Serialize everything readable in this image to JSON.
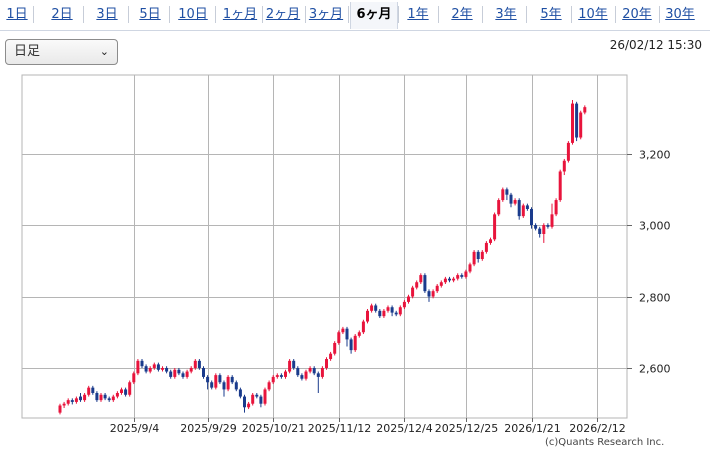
{
  "tabs": [
    {
      "label": "1日",
      "active": false
    },
    {
      "label": "2日",
      "active": false
    },
    {
      "label": "3日",
      "active": false
    },
    {
      "label": "5日",
      "active": false
    },
    {
      "label": "10日",
      "active": false
    },
    {
      "label": "1ヶ月",
      "active": false
    },
    {
      "label": "2ヶ月",
      "active": false
    },
    {
      "label": "3ヶ月",
      "active": false
    },
    {
      "label": "6ヶ月",
      "active": true
    },
    {
      "label": "1年",
      "active": false
    },
    {
      "label": "2年",
      "active": false
    },
    {
      "label": "3年",
      "active": false
    },
    {
      "label": "5年",
      "active": false
    },
    {
      "label": "10年",
      "active": false
    },
    {
      "label": "20年",
      "active": false
    },
    {
      "label": "30年",
      "active": false
    }
  ],
  "period_select": {
    "value": "日足"
  },
  "timestamp": "26/02/12 15:30",
  "copyright": "(c)Quants Research Inc.",
  "colors": {
    "up": "#e8143c",
    "down": "#1a3b8c",
    "grid": "#b5b5b5",
    "accent": "#1f4fa3"
  },
  "chart_data": {
    "type": "candlestick",
    "title": "",
    "xlabel": "",
    "ylabel": "",
    "ylim": [
      2460,
      3420
    ],
    "y_ticks": [
      {
        "value": 2600,
        "label": "2,600"
      },
      {
        "value": 2800,
        "label": "2,800"
      },
      {
        "value": 3000,
        "label": "3,000"
      },
      {
        "value": 3200,
        "label": "3,200"
      }
    ],
    "x_ticks": [
      "2025/9/4",
      "2025/9/29",
      "2025/10/21",
      "2025/11/12",
      "2025/12/4",
      "2025/12/25",
      "2026/1/21",
      "2026/2/12"
    ],
    "x_tick_index": [
      18,
      36,
      52,
      68,
      84,
      99,
      115,
      131
    ],
    "candles": [
      [
        2475,
        2495,
        2470,
        2500
      ],
      [
        2495,
        2500,
        2488,
        2505
      ],
      [
        2500,
        2510,
        2495,
        2515
      ],
      [
        2510,
        2505,
        2498,
        2515
      ],
      [
        2505,
        2515,
        2500,
        2520
      ],
      [
        2520,
        2510,
        2505,
        2530
      ],
      [
        2510,
        2525,
        2505,
        2530
      ],
      [
        2525,
        2545,
        2520,
        2550
      ],
      [
        2545,
        2530,
        2525,
        2550
      ],
      [
        2530,
        2510,
        2505,
        2535
      ],
      [
        2510,
        2525,
        2505,
        2530
      ],
      [
        2525,
        2515,
        2510,
        2530
      ],
      [
        2515,
        2510,
        2505,
        2520
      ],
      [
        2510,
        2520,
        2505,
        2525
      ],
      [
        2520,
        2530,
        2515,
        2535
      ],
      [
        2530,
        2540,
        2525,
        2545
      ],
      [
        2540,
        2525,
        2520,
        2545
      ],
      [
        2525,
        2560,
        2520,
        2565
      ],
      [
        2560,
        2585,
        2555,
        2590
      ],
      [
        2585,
        2620,
        2580,
        2625
      ],
      [
        2620,
        2605,
        2600,
        2625
      ],
      [
        2605,
        2590,
        2585,
        2610
      ],
      [
        2590,
        2600,
        2585,
        2605
      ],
      [
        2600,
        2610,
        2595,
        2615
      ],
      [
        2610,
        2595,
        2590,
        2615
      ],
      [
        2595,
        2600,
        2590,
        2605
      ],
      [
        2600,
        2590,
        2585,
        2605
      ],
      [
        2590,
        2575,
        2570,
        2595
      ],
      [
        2575,
        2595,
        2570,
        2600
      ],
      [
        2595,
        2585,
        2580,
        2600
      ],
      [
        2585,
        2575,
        2570,
        2590
      ],
      [
        2575,
        2590,
        2570,
        2595
      ],
      [
        2590,
        2600,
        2585,
        2605
      ],
      [
        2600,
        2620,
        2595,
        2625
      ],
      [
        2620,
        2600,
        2595,
        2625
      ],
      [
        2600,
        2575,
        2570,
        2605
      ],
      [
        2575,
        2560,
        2540,
        2580
      ],
      [
        2560,
        2545,
        2540,
        2565
      ],
      [
        2545,
        2580,
        2540,
        2585
      ],
      [
        2580,
        2560,
        2555,
        2585
      ],
      [
        2560,
        2540,
        2520,
        2565
      ],
      [
        2540,
        2575,
        2535,
        2580
      ],
      [
        2575,
        2560,
        2555,
        2580
      ],
      [
        2560,
        2540,
        2535,
        2565
      ],
      [
        2540,
        2520,
        2515,
        2545
      ],
      [
        2520,
        2490,
        2475,
        2525
      ],
      [
        2490,
        2500,
        2485,
        2505
      ],
      [
        2500,
        2525,
        2495,
        2530
      ],
      [
        2525,
        2520,
        2515,
        2530
      ],
      [
        2520,
        2500,
        2490,
        2525
      ],
      [
        2500,
        2540,
        2495,
        2545
      ],
      [
        2540,
        2560,
        2535,
        2565
      ],
      [
        2560,
        2575,
        2555,
        2580
      ],
      [
        2575,
        2580,
        2570,
        2585
      ],
      [
        2580,
        2575,
        2570,
        2585
      ],
      [
        2575,
        2590,
        2570,
        2595
      ],
      [
        2590,
        2620,
        2585,
        2625
      ],
      [
        2620,
        2600,
        2595,
        2625
      ],
      [
        2600,
        2580,
        2575,
        2605
      ],
      [
        2580,
        2570,
        2565,
        2585
      ],
      [
        2570,
        2590,
        2565,
        2595
      ],
      [
        2590,
        2600,
        2585,
        2605
      ],
      [
        2600,
        2585,
        2580,
        2605
      ],
      [
        2585,
        2575,
        2530,
        2590
      ],
      [
        2575,
        2600,
        2570,
        2605
      ],
      [
        2600,
        2625,
        2595,
        2630
      ],
      [
        2625,
        2640,
        2620,
        2645
      ],
      [
        2640,
        2670,
        2635,
        2675
      ],
      [
        2670,
        2700,
        2665,
        2705
      ],
      [
        2700,
        2710,
        2695,
        2715
      ],
      [
        2710,
        2680,
        2660,
        2715
      ],
      [
        2680,
        2650,
        2640,
        2685
      ],
      [
        2650,
        2690,
        2645,
        2695
      ],
      [
        2690,
        2700,
        2685,
        2705
      ],
      [
        2700,
        2730,
        2695,
        2735
      ],
      [
        2730,
        2760,
        2725,
        2765
      ],
      [
        2760,
        2775,
        2755,
        2780
      ],
      [
        2775,
        2760,
        2755,
        2780
      ],
      [
        2760,
        2745,
        2740,
        2765
      ],
      [
        2745,
        2760,
        2740,
        2765
      ],
      [
        2760,
        2770,
        2755,
        2775
      ],
      [
        2770,
        2755,
        2745,
        2775
      ],
      [
        2755,
        2750,
        2745,
        2760
      ],
      [
        2750,
        2770,
        2745,
        2775
      ],
      [
        2770,
        2785,
        2765,
        2790
      ],
      [
        2785,
        2800,
        2780,
        2805
      ],
      [
        2800,
        2825,
        2795,
        2830
      ],
      [
        2825,
        2840,
        2820,
        2845
      ],
      [
        2840,
        2860,
        2835,
        2865
      ],
      [
        2860,
        2815,
        2810,
        2865
      ],
      [
        2815,
        2800,
        2785,
        2820
      ],
      [
        2800,
        2815,
        2795,
        2820
      ],
      [
        2815,
        2830,
        2810,
        2835
      ],
      [
        2830,
        2840,
        2825,
        2845
      ],
      [
        2840,
        2850,
        2835,
        2855
      ],
      [
        2850,
        2845,
        2840,
        2855
      ],
      [
        2845,
        2850,
        2840,
        2855
      ],
      [
        2850,
        2860,
        2845,
        2865
      ],
      [
        2860,
        2855,
        2850,
        2865
      ],
      [
        2855,
        2870,
        2850,
        2875
      ],
      [
        2870,
        2890,
        2865,
        2895
      ],
      [
        2890,
        2925,
        2885,
        2930
      ],
      [
        2925,
        2905,
        2895,
        2930
      ],
      [
        2905,
        2925,
        2900,
        2930
      ],
      [
        2925,
        2950,
        2920,
        2955
      ],
      [
        2950,
        2960,
        2945,
        2965
      ],
      [
        2960,
        3030,
        2955,
        3035
      ],
      [
        3030,
        3070,
        3025,
        3075
      ],
      [
        3070,
        3100,
        3065,
        3105
      ],
      [
        3100,
        3085,
        3070,
        3105
      ],
      [
        3085,
        3060,
        3050,
        3090
      ],
      [
        3060,
        3070,
        3055,
        3075
      ],
      [
        3070,
        3025,
        3015,
        3075
      ],
      [
        3025,
        3055,
        3020,
        3060
      ],
      [
        3055,
        3045,
        3040,
        3060
      ],
      [
        3045,
        3000,
        2990,
        3050
      ],
      [
        3000,
        2990,
        2985,
        3005
      ],
      [
        2990,
        2975,
        2965,
        2995
      ],
      [
        2975,
        3000,
        2950,
        3005
      ],
      [
        3000,
        2995,
        2990,
        3005
      ],
      [
        2995,
        3030,
        2990,
        3060
      ],
      [
        3030,
        3070,
        3025,
        3075
      ],
      [
        3070,
        3150,
        3065,
        3155
      ],
      [
        3150,
        3180,
        3140,
        3185
      ],
      [
        3180,
        3230,
        3175,
        3235
      ],
      [
        3230,
        3340,
        3225,
        3350
      ],
      [
        3340,
        3245,
        3235,
        3345
      ],
      [
        3245,
        3315,
        3240,
        3320
      ],
      [
        3315,
        3330,
        3310,
        3335
      ]
    ]
  }
}
